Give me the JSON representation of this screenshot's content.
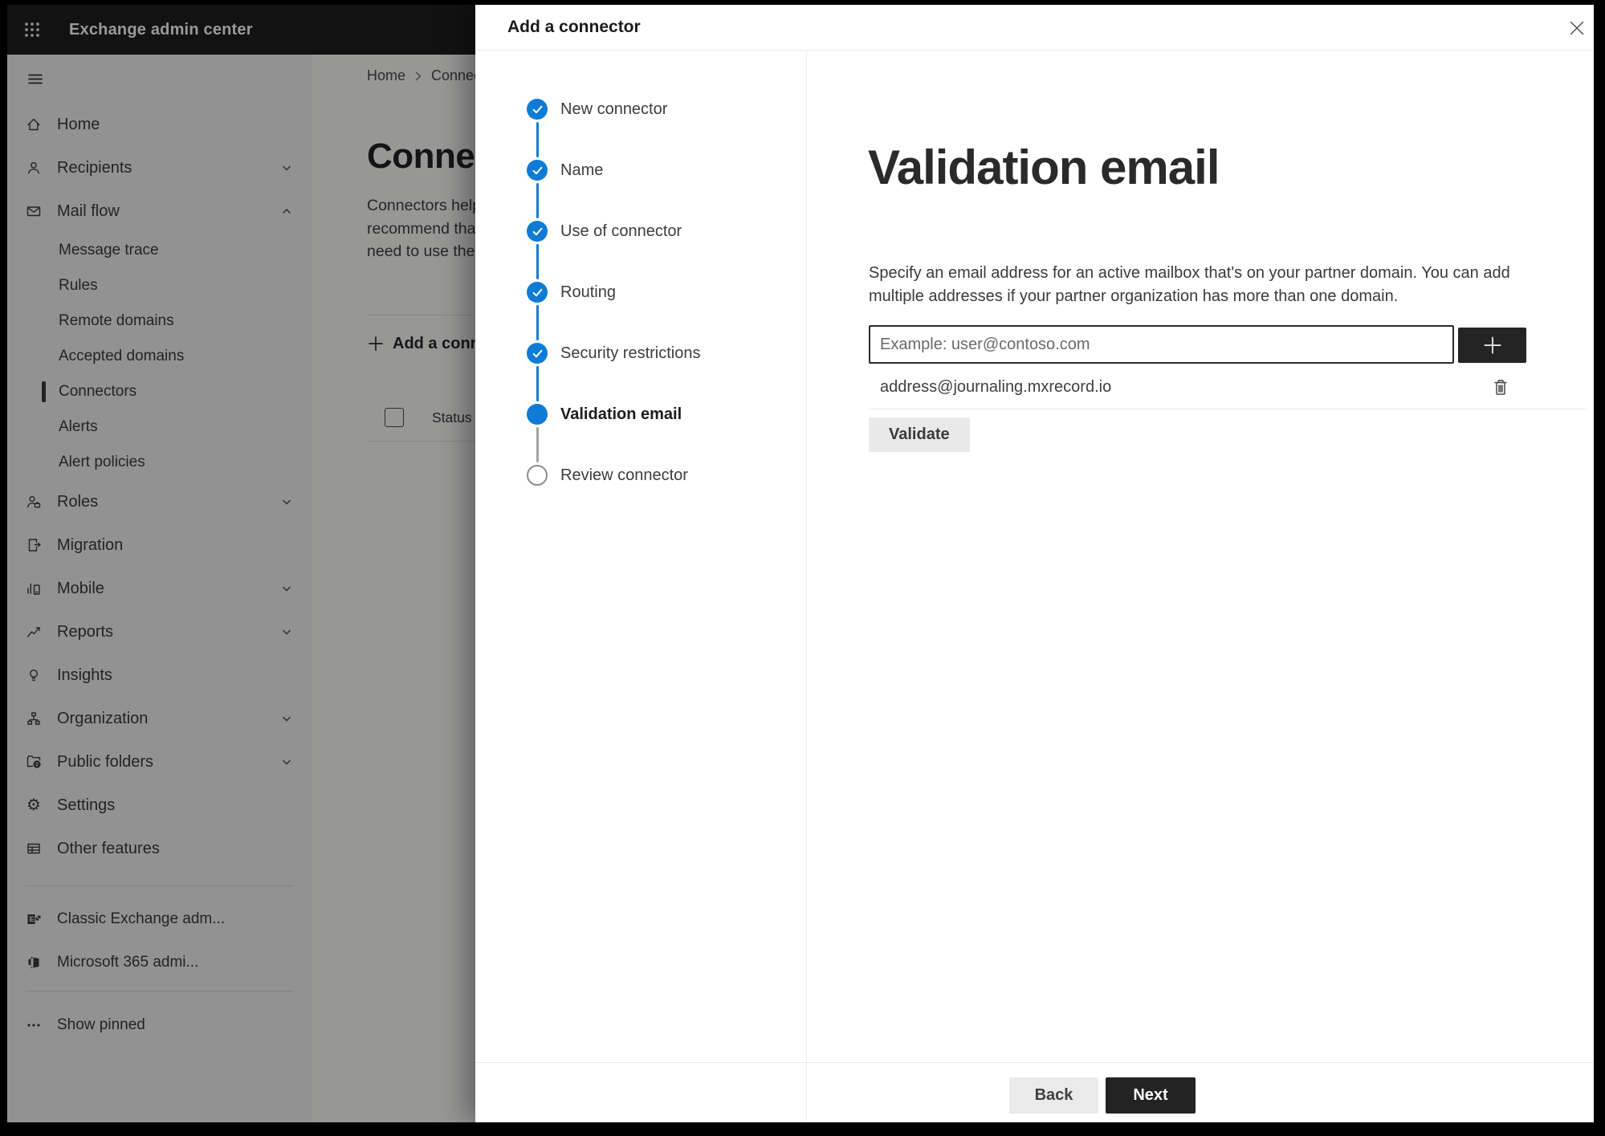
{
  "app": {
    "title": "Exchange admin center"
  },
  "sidebar": {
    "items": [
      {
        "label": "Home",
        "icon": "home",
        "type": "top"
      },
      {
        "label": "Recipients",
        "icon": "person",
        "type": "top",
        "chevron": "down"
      },
      {
        "label": "Mail flow",
        "icon": "mail",
        "type": "top",
        "chevron": "up",
        "expanded": true
      },
      {
        "label": "Message trace",
        "type": "sub"
      },
      {
        "label": "Rules",
        "type": "sub"
      },
      {
        "label": "Remote domains",
        "type": "sub"
      },
      {
        "label": "Accepted domains",
        "type": "sub"
      },
      {
        "label": "Connectors",
        "type": "sub",
        "selected": true
      },
      {
        "label": "Alerts",
        "type": "sub"
      },
      {
        "label": "Alert policies",
        "type": "sub"
      },
      {
        "label": "Roles",
        "icon": "roles",
        "type": "top",
        "chevron": "down"
      },
      {
        "label": "Migration",
        "icon": "migration",
        "type": "top"
      },
      {
        "label": "Mobile",
        "icon": "mobile",
        "type": "top",
        "chevron": "down"
      },
      {
        "label": "Reports",
        "icon": "reports",
        "type": "top",
        "chevron": "down"
      },
      {
        "label": "Insights",
        "icon": "insights",
        "type": "top"
      },
      {
        "label": "Organization",
        "icon": "organization",
        "type": "top",
        "chevron": "down"
      },
      {
        "label": "Public folders",
        "icon": "public-folders",
        "type": "top",
        "chevron": "down"
      },
      {
        "label": "Settings",
        "icon": "settings",
        "type": "top"
      },
      {
        "label": "Other features",
        "icon": "other-features",
        "type": "top"
      }
    ],
    "footer": {
      "classic": "Classic Exchange adm...",
      "m365": "Microsoft 365 admi...",
      "pinned": "Show pinned"
    }
  },
  "background": {
    "breadcrumb_home": "Home",
    "breadcrumb_current": "Connect",
    "heading": "Connect",
    "para": [
      "Connectors help",
      "recommend that",
      "need to use ther"
    ],
    "add_button": "Add a conn",
    "status_header": "Status"
  },
  "dialog": {
    "title": "Add a connector",
    "steps": [
      {
        "label": "New connector",
        "status": "done"
      },
      {
        "label": "Name",
        "status": "done"
      },
      {
        "label": "Use of connector",
        "status": "done"
      },
      {
        "label": "Routing",
        "status": "done"
      },
      {
        "label": "Security restrictions",
        "status": "done"
      },
      {
        "label": "Validation email",
        "status": "current"
      },
      {
        "label": "Review connector",
        "status": "todo"
      }
    ],
    "heading": "Validation email",
    "desc1": "Specify an email address for an active mailbox that's on your partner domain. You can add",
    "desc2": "multiple addresses if your partner organization has more than one domain.",
    "placeholder": "Example: user@contoso.com",
    "address": "address@journaling.mxrecord.io",
    "validate": "Validate",
    "back": "Back",
    "next": "Next"
  },
  "colors": {
    "accent_blue": "#0f7bd7",
    "topbar": "#1f1f1f",
    "dark_button": "#232323",
    "overlay": "rgba(0,0,0,0.40)"
  }
}
